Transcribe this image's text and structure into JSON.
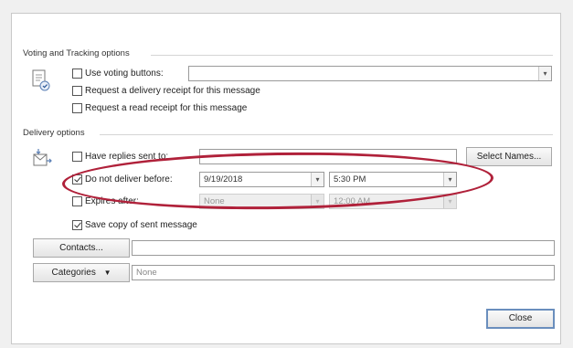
{
  "voting": {
    "group_title": "Voting and Tracking options",
    "use_voting_label": "Use voting buttons:",
    "use_voting_value": "",
    "use_voting_checked": false,
    "delivery_receipt_label": "Request a delivery receipt for this message",
    "delivery_receipt_checked": false,
    "read_receipt_label": "Request a read receipt for this message",
    "read_receipt_checked": false
  },
  "delivery": {
    "group_title": "Delivery options",
    "replies_label": "Have replies sent to:",
    "replies_value": "",
    "replies_checked": false,
    "select_names_label": "Select Names...",
    "do_not_deliver_label": "Do not deliver before:",
    "do_not_deliver_checked": true,
    "deliver_date": "9/19/2018",
    "deliver_time": "5:30 PM",
    "expires_label": "Expires after:",
    "expires_checked": false,
    "expires_date": "None",
    "expires_time": "12:00 AM",
    "save_copy_label": "Save copy of sent message",
    "save_copy_checked": true
  },
  "contacts": {
    "button_label": "Contacts...",
    "value": ""
  },
  "categories": {
    "button_label": "Categories",
    "arrow": "▼",
    "value": "None"
  },
  "footer": {
    "close_label": "Close"
  },
  "colors": {
    "annotation_ellipse": "#b0213a",
    "close_border": "#6a8ebd"
  },
  "icons": {
    "voting": "voting-tracking-icon",
    "delivery": "delivery-options-icon"
  }
}
